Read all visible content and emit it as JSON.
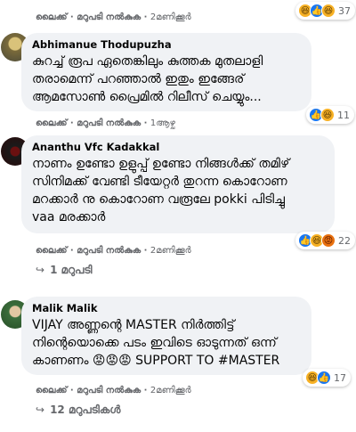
{
  "comments": [
    {
      "actions": {
        "like": "ലൈക്ക്",
        "reply": "മറുപടി നൽകുക",
        "time": "2മണിക്കൂർ"
      },
      "reactions": {
        "icons": [
          "haha-icon",
          "like-icon",
          "haha-icon"
        ],
        "count": "37"
      }
    },
    {
      "name": "Abhimanue Thodupuzha",
      "lines": [
        "കുറച്ച് രൂപ ഏതെങ്കിലും കുത്തക മുതലാളി",
        "തരാമെന്ന് പറഞ്ഞാൽ ഇതും ഇങ്ങേര്",
        "ആമസോൺ പ്രൈമിൽ റിലീസ് ചെയ്യും..."
      ],
      "actions": {
        "like": "ലൈക്ക്",
        "reply": "മറുപടി നൽകുക",
        "time": "1ആഴ്ച"
      },
      "reactions": {
        "icons": [
          "like-icon",
          "haha-icon"
        ],
        "count": "11"
      }
    },
    {
      "name": "Ananthu Vfc Kadakkal",
      "lines": [
        "നാണം ഉണ്ടോ ഉളുപ്പ് ഉണ്ടോ നിങ്ങൾക്ക് തമിഴ്",
        "സിനിമക്ക് വേണ്ടി ടീയേറ്റർ തുറന്ന കൊറോണ",
        "മറക്കാർ നു കൊറോണ വരൂലേ pokki പിടിച്ചു",
        "vaa മരക്കാർ"
      ],
      "actions": {
        "like": "ലൈക്ക്",
        "reply": "മറുപടി നൽകുക",
        "time": "2മണിക്കൂർ"
      },
      "reactions": {
        "icons": [
          "like-icon",
          "haha-icon",
          "angry-icon"
        ],
        "count": "22"
      },
      "replies": "1 മറുപടി"
    },
    {
      "name": "Malik Malik",
      "lines": [
        "VIJAY അണ്ണന്റെ MASTER നിർത്തിട്ട്",
        "നിന്റെയൊക്കെ പടം ഇവിടെ ഓടുന്നത് ഒന്ന്",
        "കാണണം 😡😡😡 SUPPORT TO #MASTER"
      ],
      "actions": {
        "like": "ലൈക്ക്",
        "reply": "മറുപടി നൽകുക",
        "time": "2മണിക്കൂർ"
      },
      "reactions": {
        "icons": [
          "haha-icon",
          "like-icon"
        ],
        "count": "17"
      },
      "replies": "12 മറുപടികൾ"
    }
  ],
  "colors": {
    "bubble": "#f0f2f5",
    "meta": "#65676b",
    "like": "#1877f2",
    "haha": "#f7b125",
    "angry": "#e9710f"
  }
}
